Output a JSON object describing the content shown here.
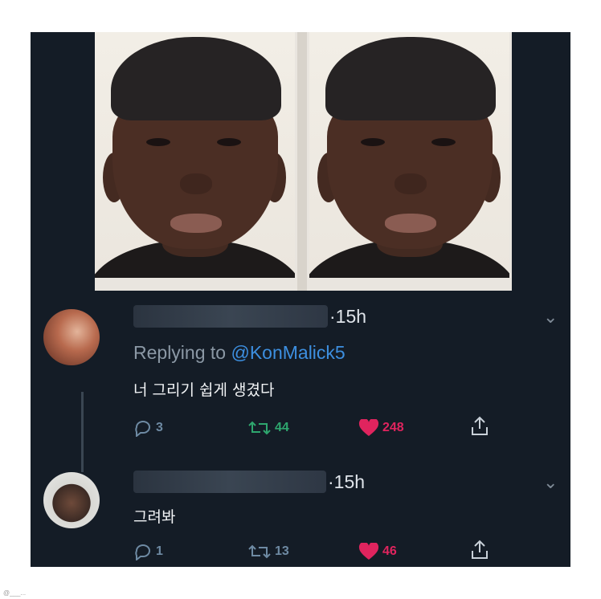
{
  "tweets": [
    {
      "time": "·15h",
      "replying_prefix": "Replying to ",
      "replying_handle": "@KonMalick5",
      "text": "너 그리기 쉽게 생겼다",
      "actions": {
        "replies": "3",
        "retweets": "44",
        "likes": "248"
      }
    },
    {
      "time": "·15h",
      "text": "그려봐",
      "actions": {
        "replies": "1",
        "retweets": "13",
        "likes": "46"
      }
    }
  ],
  "icons": {
    "reply": "reply-icon",
    "retweet": "retweet-icon",
    "like": "heart-icon",
    "share": "share-icon",
    "more": "chevron-down-icon"
  },
  "colors": {
    "background": "#141c26",
    "link": "#3d8fe0",
    "retweet": "#2ea66e",
    "like": "#e0245e"
  },
  "watermark": "@___..."
}
